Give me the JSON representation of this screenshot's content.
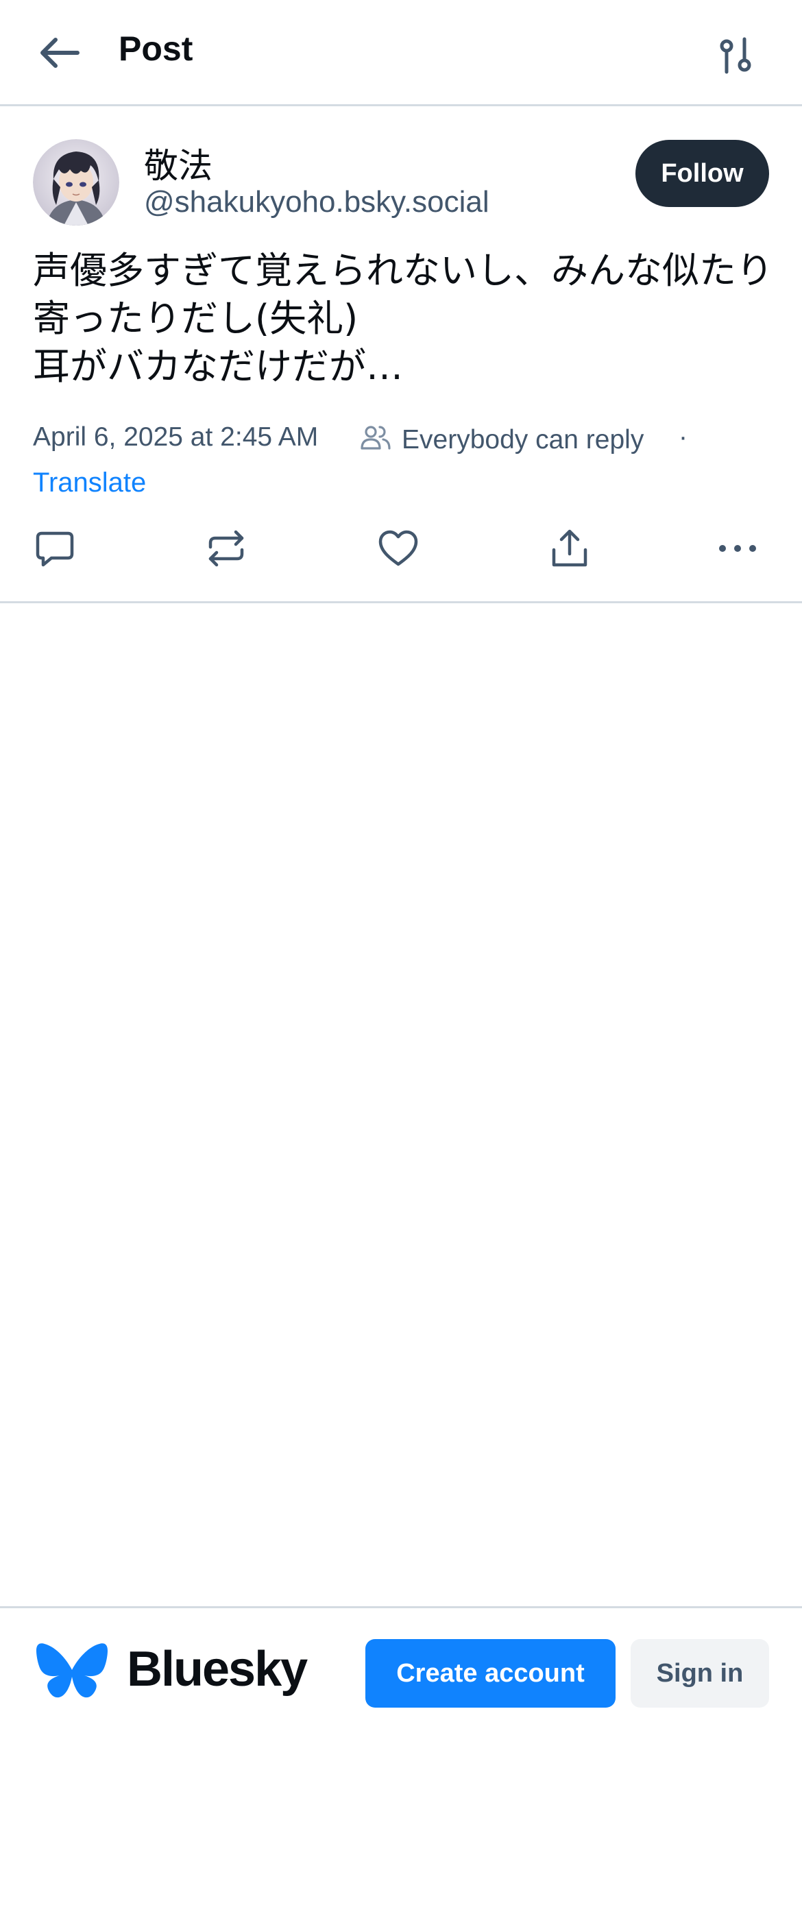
{
  "header": {
    "back_icon": "arrow-left-icon",
    "title": "Post",
    "filter_icon": "sliders-icon"
  },
  "post": {
    "author_name": "敬法",
    "author_handle": "@shakukyoho.bsky.social",
    "follow_label": "Follow",
    "text": "声優多すぎて覚えられないし、みんな似たり寄ったりだし(失礼)\n耳がバカなだけだが…",
    "timestamp": "April 6, 2025 at 2:45 AM",
    "reply_setting": "Everybody can reply",
    "separator": "·",
    "translate_label": "Translate",
    "actions": [
      "reply-icon",
      "repost-icon",
      "like-icon",
      "share-icon",
      "more-icon"
    ]
  },
  "footer": {
    "brand": "Bluesky",
    "create_account_label": "Create account",
    "sign_in_label": "Sign in"
  },
  "colors": {
    "accent": "#1083fe",
    "follow_bg": "#1f2b38",
    "muted_text": "#42566c",
    "divider": "#d4dbe2"
  }
}
